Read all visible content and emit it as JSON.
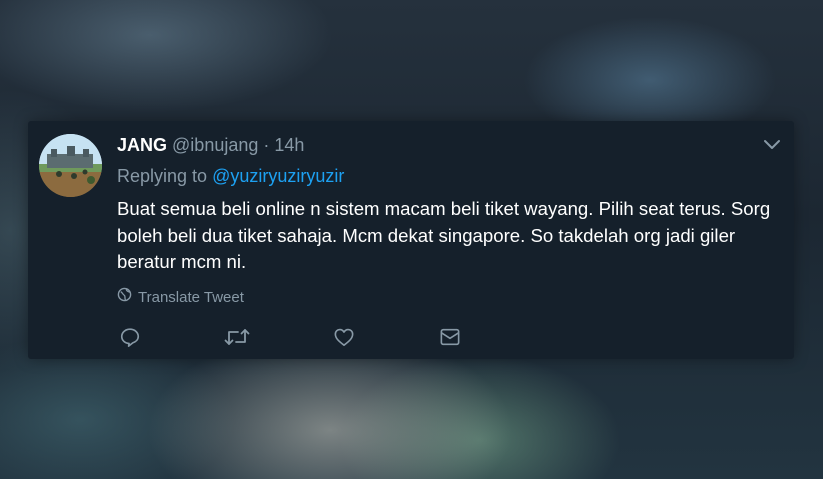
{
  "tweet": {
    "display_name": "JANG",
    "handle": "@ibnujang",
    "separator": "·",
    "time": "14h",
    "replying_prefix": "Replying to",
    "replying_handle": "@yuziryuziryuzir",
    "text": "Buat semua beli online n sistem macam beli tiket wayang. Pilih seat terus. Sorg boleh beli dua tiket sahaja. Mcm dekat singapore. So takdelah org jadi giler beratur mcm ni.",
    "translate_label": "Translate Tweet"
  },
  "icons": {
    "menu": "chevron-down-icon",
    "translate": "globe-icon",
    "reply": "speech-bubble-icon",
    "retweet": "retweet-icon",
    "like": "heart-icon",
    "message": "envelope-icon"
  },
  "colors": {
    "card_background": "#15202b",
    "text_primary": "#ffffff",
    "text_secondary": "#8899a6",
    "link": "#1da1f2"
  }
}
